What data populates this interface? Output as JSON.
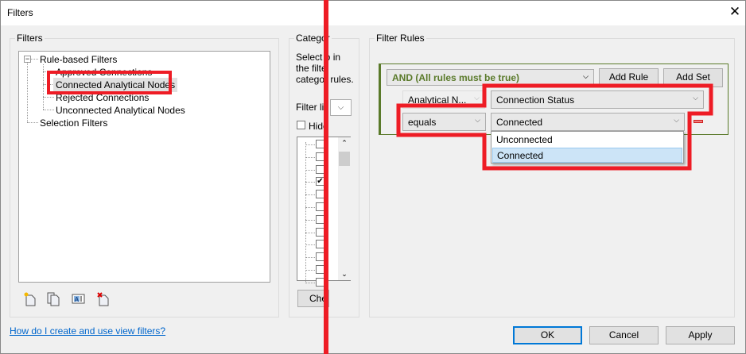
{
  "window": {
    "title": "Filters",
    "close_icon": "close-icon"
  },
  "filters_panel": {
    "label": "Filters",
    "tree": {
      "root1": "Rule-based Filters",
      "children": [
        "Approved Connections",
        "Connected Analytical Nodes",
        "Rejected Connections",
        "Unconnected Analytical Nodes"
      ],
      "selected": "Connected Analytical Nodes",
      "root2": "Selection Filters"
    },
    "toolbar_icons": [
      "new-filter-icon",
      "duplicate-filter-icon",
      "rename-filter-icon",
      "delete-filter-icon"
    ]
  },
  "categories_panel": {
    "label": "Categor",
    "description": [
      "Select o",
      "in",
      "the filte",
      "categor",
      "rules."
    ],
    "filter_list_label": "Filter lis",
    "hide_label": "Hide",
    "checkboxes": [
      false,
      false,
      false,
      true,
      false,
      false,
      false,
      false,
      false,
      false,
      false,
      false
    ],
    "check_button": "Che"
  },
  "rules_panel": {
    "label": "Filter Rules",
    "logic": "AND (All rules must be true)",
    "add_rule": "Add Rule",
    "add_set": "Add Set",
    "category": "Analytical N...",
    "parameter": "Connection Status",
    "operator": "equals",
    "value": "Connected",
    "dropdown_options": [
      "Unconnected",
      "Connected"
    ],
    "highlighted_option": "Connected",
    "accent_color": "#5a7a2a"
  },
  "footer": {
    "help_link": "How do I create and use view filters?",
    "ok": "OK",
    "cancel": "Cancel",
    "apply": "Apply"
  },
  "annotation_color": "#ee1c25"
}
